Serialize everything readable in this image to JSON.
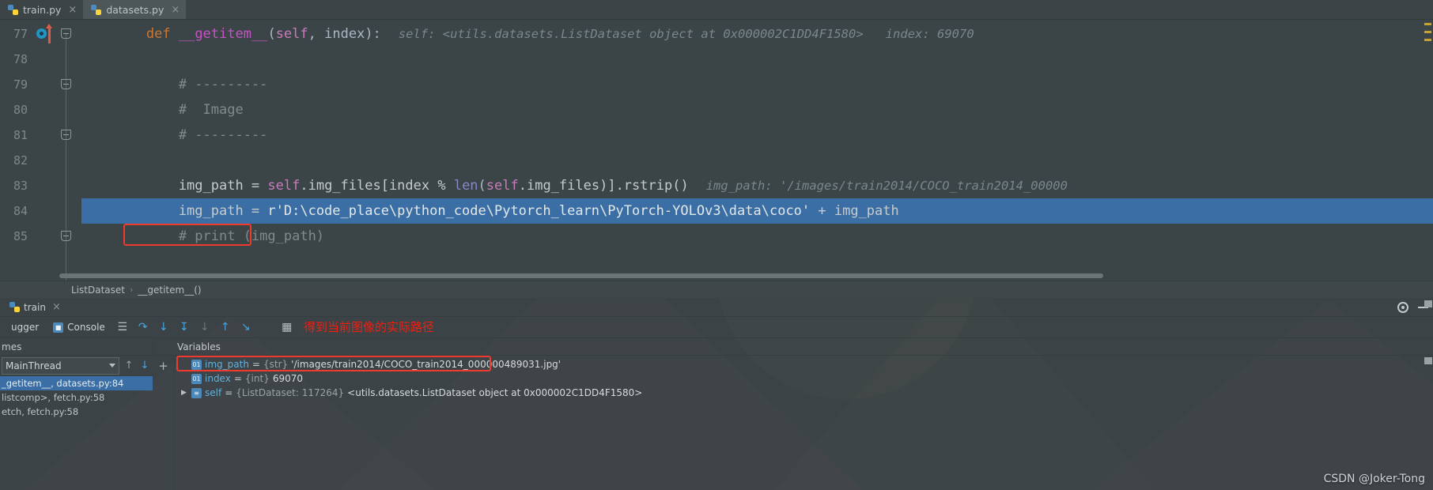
{
  "window": {
    "watermark": "CSDN @Joker-Tong"
  },
  "editor": {
    "tabs": [
      {
        "label": "train.py",
        "icon": "python-file-icon",
        "active": false,
        "close": "×"
      },
      {
        "label": "datasets.py",
        "icon": "python-file-icon",
        "active": true,
        "close": "×"
      }
    ],
    "lines": [
      {
        "no": "77",
        "segments": [
          {
            "t": "        ",
            "c": "tok-plain"
          },
          {
            "t": "def ",
            "c": "tok-kw"
          },
          {
            "t": "__getitem__",
            "c": "tok-fn"
          },
          {
            "t": "(",
            "c": "tok-punc"
          },
          {
            "t": "self",
            "c": "tok-self"
          },
          {
            "t": ", ",
            "c": "tok-punc"
          },
          {
            "t": "index",
            "c": "tok-punc"
          },
          {
            "t": "):",
            "c": "tok-punc"
          }
        ],
        "hint": "self: <utils.datasets.ListDataset object at 0x000002C1DD4F1580>   index: 69070"
      },
      {
        "no": "78",
        "segments": [],
        "hint": ""
      },
      {
        "no": "79",
        "segments": [
          {
            "t": "            # ---------",
            "c": "tok-cmt"
          }
        ],
        "hint": ""
      },
      {
        "no": "80",
        "segments": [
          {
            "t": "            #  Image",
            "c": "tok-cmt"
          }
        ],
        "hint": ""
      },
      {
        "no": "81",
        "segments": [
          {
            "t": "            # ---------",
            "c": "tok-cmt"
          }
        ],
        "hint": ""
      },
      {
        "no": "82",
        "segments": [],
        "hint": ""
      },
      {
        "no": "83",
        "segments": [
          {
            "t": "            img_path = ",
            "c": "tok-plain"
          },
          {
            "t": "self",
            "c": "tok-self"
          },
          {
            "t": ".img_files[index % ",
            "c": "tok-plain"
          },
          {
            "t": "len",
            "c": "tok-bi"
          },
          {
            "t": "(",
            "c": "tok-punc"
          },
          {
            "t": "self",
            "c": "tok-self"
          },
          {
            "t": ".img_files)].rstrip()",
            "c": "tok-plain"
          }
        ],
        "hint": "img_path: '/images/train2014/COCO_train2014_00000"
      },
      {
        "no": "84",
        "highlighted": true,
        "segments": [
          {
            "t": "            img_path = ",
            "c": "tok-plain"
          },
          {
            "t": "r'D:\\code_place\\python_code\\Pytorch_learn\\PyTorch-YOLOv3\\data\\coco'",
            "c": "tok-str"
          },
          {
            "t": " + img_path",
            "c": "tok-plain"
          }
        ],
        "hint": ""
      },
      {
        "no": "85",
        "segments": [
          {
            "t": "            # print (img_path)",
            "c": "tok-cmt"
          }
        ],
        "hint": ""
      }
    ],
    "breadcrumb": {
      "items": [
        "ListDataset",
        "__getitem__()"
      ],
      "separator": "›"
    }
  },
  "debug": {
    "tab": {
      "label": "train",
      "icon": "python-file-icon",
      "close": "×"
    },
    "header_icons": [
      "gear-icon",
      "minimize-icon"
    ],
    "subtabs": [
      {
        "label": "ugger",
        "icon": "debugger-icon"
      },
      {
        "label": "Console",
        "icon": "console-icon"
      }
    ],
    "toolbar_icons": [
      "show-execution-point-icon",
      "step-over-icon",
      "step-into-icon",
      "force-step-into-icon",
      "step-out-icon",
      "run-to-cursor-icon",
      "evaluate-expression-icon"
    ],
    "annotation": "得到当前图像的实际路径",
    "frames_header": "mes",
    "thread_selector": {
      "value": "MainThread",
      "icon": "chevron-down-icon"
    },
    "frames": [
      {
        "text": "_getitem__, datasets.py:84",
        "selected": true
      },
      {
        "text": "listcomp>, fetch.py:58",
        "selected": false
      },
      {
        "text": "etch, fetch.py:58",
        "selected": false
      }
    ],
    "variables_header": "Variables",
    "add_button": "+",
    "variables": [
      {
        "badge": "01",
        "name": "img_path",
        "eq": "=",
        "type": "{str}",
        "value": "'/images/train2014/COCO_train2014_000000489031.jpg'",
        "disclosure": "",
        "boxed": true
      },
      {
        "badge": "01",
        "name": "index",
        "eq": "=",
        "type": "{int}",
        "value": "69070",
        "disclosure": "",
        "boxed": false
      },
      {
        "badge": "≡",
        "name": "self",
        "eq": "=",
        "type": "{ListDataset: 117264}",
        "value": "<utils.datasets.ListDataset object at 0x000002C1DD4F1580>",
        "disclosure": "▶",
        "boxed": false
      }
    ]
  },
  "colors": {
    "accent_blue": "#3a6ea5",
    "annotation_red": "#f41d0e",
    "box_red": "#ef3a2d",
    "editor_bg": "#3b4447",
    "keyword_orange": "#cc7832",
    "function_magenta": "#c653c6",
    "self_pink": "#c77dbb",
    "builtin_purple": "#8888c6",
    "comment_grey": "#808b8d",
    "var_blue": "#60b2e0"
  }
}
